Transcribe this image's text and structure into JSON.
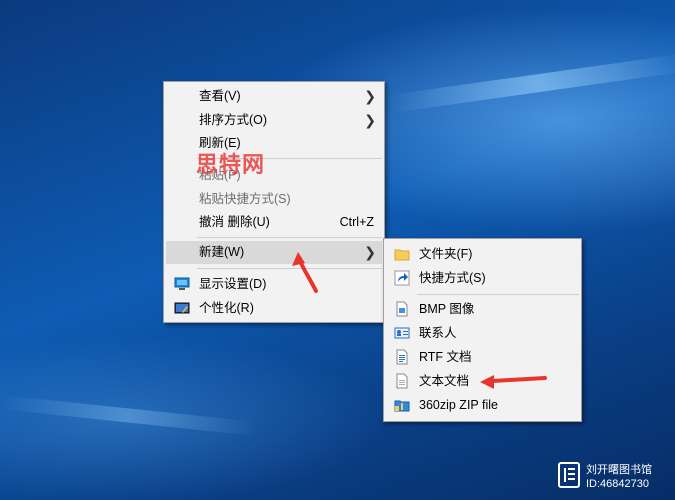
{
  "context_menu": {
    "items": [
      {
        "label": "查看(V)",
        "submenu": true
      },
      {
        "label": "排序方式(O)",
        "submenu": true
      },
      {
        "label": "刷新(E)"
      },
      {
        "label": "粘贴(P)",
        "disabled": true
      },
      {
        "label": "粘贴快捷方式(S)",
        "disabled": true
      },
      {
        "label": "撤消 删除(U)",
        "shortcut": "Ctrl+Z"
      },
      {
        "label": "新建(W)",
        "submenu": true,
        "highlighted": true
      },
      {
        "label": "显示设置(D)",
        "icon": "display-settings-icon"
      },
      {
        "label": "个性化(R)",
        "icon": "personalize-icon"
      }
    ]
  },
  "new_submenu": {
    "items": [
      {
        "label": "文件夹(F)",
        "icon": "folder-icon"
      },
      {
        "label": "快捷方式(S)",
        "icon": "shortcut-icon"
      },
      {
        "label": "BMP 图像",
        "icon": "bmp-image-icon"
      },
      {
        "label": "联系人",
        "icon": "contact-icon"
      },
      {
        "label": "RTF 文档",
        "icon": "rtf-document-icon"
      },
      {
        "label": "文本文档",
        "icon": "text-document-icon"
      },
      {
        "label": "360zip ZIP file",
        "icon": "zip-file-icon"
      }
    ]
  },
  "watermark": {
    "text": "思特网"
  },
  "corner_badge": {
    "line1": "刘开曙图书馆",
    "line2": "ID:46842730"
  },
  "colors": {
    "arrow": "#e8352c",
    "menu_bg": "#f2f2f2",
    "highlight": "#d9d9d9"
  }
}
